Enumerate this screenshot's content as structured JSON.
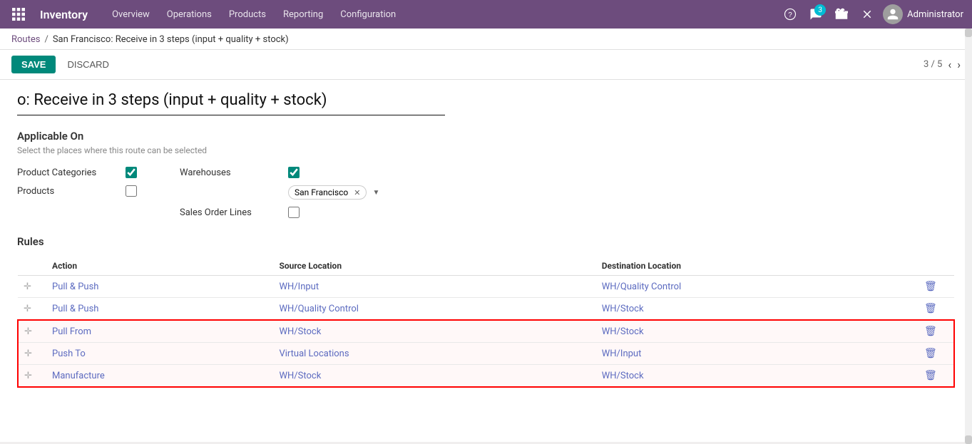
{
  "topbar": {
    "brand": "Inventory",
    "nav": [
      "Overview",
      "Operations",
      "Products",
      "Reporting",
      "Configuration"
    ],
    "notification_count": "3",
    "user": "Administrator"
  },
  "breadcrumb": {
    "link": "Routes",
    "separator": "/",
    "current": "San Francisco: Receive in 3 steps (input + quality + stock)"
  },
  "actions": {
    "save": "SAVE",
    "discard": "DISCARD",
    "pagination": "3 / 5"
  },
  "form": {
    "title": "o: Receive in 3 steps (input + quality + stock)",
    "applicable_on_label": "Applicable On",
    "applicable_on_sub": "Select the places where this route can be selected",
    "product_categories_label": "Product Categories",
    "products_label": "Products",
    "warehouses_label": "Warehouses",
    "sales_order_lines_label": "Sales Order Lines",
    "warehouse_tag": "San Francisco"
  },
  "rules": {
    "title": "Rules",
    "columns": [
      "Action",
      "Source Location",
      "Destination Location"
    ],
    "rows": [
      {
        "action": "Pull & Push",
        "source": "WH/Input",
        "destination": "WH/Quality Control",
        "highlighted": false
      },
      {
        "action": "Pull & Push",
        "source": "WH/Quality Control",
        "destination": "WH/Stock",
        "highlighted": false
      },
      {
        "action": "Pull From",
        "source": "WH/Stock",
        "destination": "WH/Stock",
        "highlighted": true
      },
      {
        "action": "Push To",
        "source": "Virtual Locations",
        "destination": "WH/Input",
        "highlighted": true
      },
      {
        "action": "Manufacture",
        "source": "WH/Stock",
        "destination": "WH/Stock",
        "highlighted": true
      }
    ]
  }
}
